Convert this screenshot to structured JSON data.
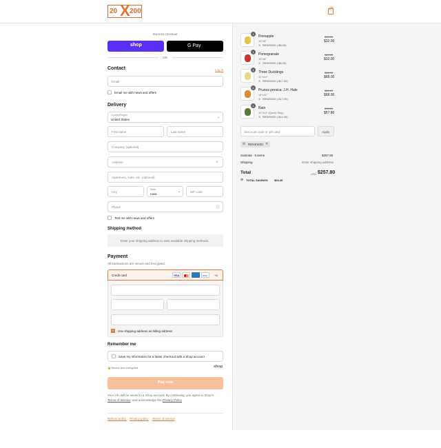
{
  "logo": {
    "left": "20",
    "mid": "X",
    "right": "200"
  },
  "express": {
    "label": "Express checkout",
    "shop_pay": "shop",
    "google_pay": "G Pay",
    "or": "OR"
  },
  "contact": {
    "title": "Contact",
    "login_link": "Log in",
    "email_placeholder": "Email",
    "newsletter": "Email me with news and offers"
  },
  "delivery": {
    "title": "Delivery",
    "country_label": "Country/Region",
    "country_value": "United States",
    "first_name": "First name",
    "last_name": "Last name",
    "company": "Company (optional)",
    "address": "Address",
    "apartment": "Apartment, suite, etc. (optional)",
    "city": "City",
    "state_label": "State",
    "state_value": "Iowa",
    "zip": "ZIP code",
    "phone": "Phone",
    "sms": "Text me with news and offers"
  },
  "shipping": {
    "title": "Shipping method",
    "message": "Enter your shipping address to view available shipping methods."
  },
  "payment": {
    "title": "Payment",
    "subtitle": "All transactions are secure and encrypted.",
    "credit_card": "Credit card",
    "cards": [
      "VISA",
      "MC",
      "AMEX",
      "DISC",
      "+3"
    ],
    "billing_same": "Use shipping address as billing address"
  },
  "remember": {
    "title": "Remember me",
    "save_info": "Save my information for a faster checkout with a Shop account",
    "secure": "Secure and encrypted",
    "shop_logo": "shop"
  },
  "pay_now": "Pay now",
  "legal": {
    "line1": "Your info will be saved to a Shop account. By continuing, you agree to Shop's",
    "terms": "Terms of Service",
    "and": "and acknowledge the",
    "privacy": "Privacy Policy"
  },
  "footer_links": [
    "Refund policy",
    "Privacy policy",
    "Terms of service"
  ],
  "order": {
    "items": [
      {
        "qty": "1",
        "name": "Pineapple",
        "size": "15\"x8\"",
        "discount": "RENEW20 (-$8.00)",
        "original": "$40.00",
        "price": "$32.00",
        "color": "#e6c34a"
      },
      {
        "qty": "1",
        "name": "Pomegranate",
        "size": "15\"x8\"",
        "discount": "RENEW20 (-$8.00)",
        "original": "$40.00",
        "price": "$32.00",
        "color": "#c23a2e"
      },
      {
        "qty": "1",
        "name": "Three Ducklings",
        "size": "11\"x14\"",
        "discount": "RENEW20 (-$17.00)",
        "original": "$85.00",
        "price": "$68.00",
        "color": "#e8d88a"
      },
      {
        "qty": "1",
        "name": "Prunus persica: J.H. Hale",
        "size": "14\"x11\"",
        "discount": "RENEW20 (-$17.00)",
        "original": "$85.00",
        "price": "$68.00",
        "color": "#d98a3a"
      },
      {
        "qty": "1",
        "name": "Rain",
        "size": "11\"x14\" (Quick Ship)",
        "discount": "RENEW20 (-$14.45)",
        "original": "$72.25",
        "price": "$57.80",
        "color": "#5a7a3a"
      }
    ],
    "discount_placeholder": "Discount code or gift card",
    "apply": "Apply",
    "applied_code": "RENEW20",
    "subtotal_label": "Subtotal · 5 items",
    "subtotal_value": "$257.80",
    "shipping_label": "Shipping",
    "shipping_value": "Enter shipping address",
    "total_label": "Total",
    "currency": "USD",
    "total_value": "$257.80",
    "savings_label": "TOTAL SAVINGS",
    "savings_value": "$64.45"
  },
  "colors": {
    "accent": "#e07a3a",
    "shop_purple": "#5a31f4",
    "pay_now_bg": "#f7bf9c"
  }
}
